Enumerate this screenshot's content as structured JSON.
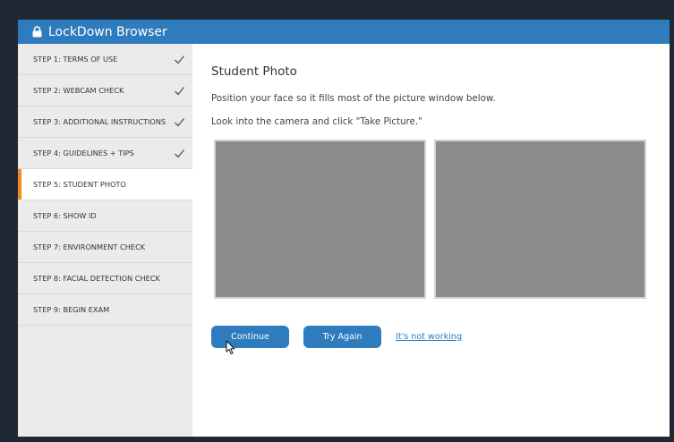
{
  "window": {
    "title": "LockDown Browser"
  },
  "sidebar": {
    "steps": [
      {
        "label": "STEP 1: TERMS OF USE",
        "completed": true,
        "active": false
      },
      {
        "label": "STEP 2: WEBCAM CHECK",
        "completed": true,
        "active": false
      },
      {
        "label": "STEP 3: ADDITIONAL INSTRUCTIONS",
        "completed": true,
        "active": false
      },
      {
        "label": "STEP 4: GUIDELINES + TIPS",
        "completed": true,
        "active": false
      },
      {
        "label": "STEP 5: STUDENT PHOTO",
        "completed": false,
        "active": true
      },
      {
        "label": "STEP 6: SHOW ID",
        "completed": false,
        "active": false
      },
      {
        "label": "STEP 7: ENVIRONMENT CHECK",
        "completed": false,
        "active": false
      },
      {
        "label": "STEP 8: FACIAL DETECTION CHECK",
        "completed": false,
        "active": false
      },
      {
        "label": "STEP 9: BEGIN EXAM",
        "completed": false,
        "active": false
      }
    ]
  },
  "main": {
    "title": "Student Photo",
    "instruction_1": "Position your face so it fills most of the picture window below.",
    "instruction_2": "Look into the camera and click \"Take Picture.\"",
    "continue_label": "Continue",
    "try_again_label": "Try Again",
    "not_working_label": "It's not working"
  },
  "colors": {
    "titlebar": "#2e7bbd",
    "active_indicator": "#f28b1e",
    "sidebar_bg": "#ebebeb",
    "photo_placeholder": "#8c8c8c"
  }
}
